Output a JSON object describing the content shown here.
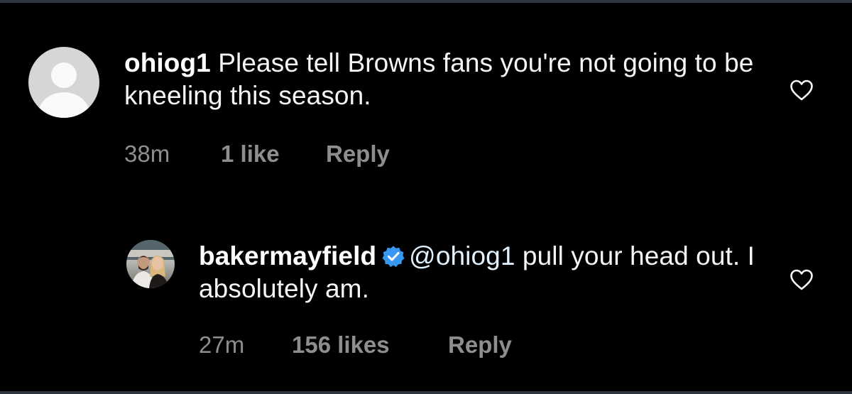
{
  "comments": [
    {
      "username": "ohiog1",
      "text": "Please tell Browns fans you're not going to be kneeling this season.",
      "time": "38m",
      "likes": "1 like",
      "reply_label": "Reply",
      "avatar": "default-avatar-icon",
      "liked": false
    },
    {
      "username": "bakermayfield",
      "verified": true,
      "mention": "@ohiog1",
      "text": "pull your head out. I absolutely am.",
      "time": "27m",
      "likes": "156 likes",
      "reply_label": "Reply",
      "avatar": "profile-photo",
      "liked": false
    }
  ],
  "colors": {
    "background": "#000000",
    "text": "#f5f5f5",
    "meta": "#8e8e8e",
    "verified_badge": "#3897f0",
    "default_avatar": "#d6d6d6"
  }
}
